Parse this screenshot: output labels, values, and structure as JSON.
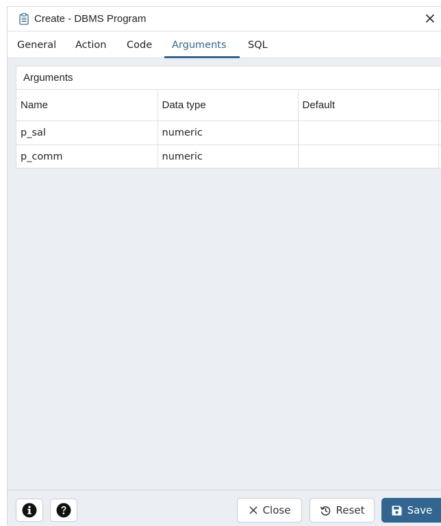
{
  "dialog": {
    "title": "Create - DBMS Program",
    "title_icon": "clipboard-icon",
    "close_icon": "close-icon"
  },
  "tabs": [
    {
      "label": "General",
      "active": false
    },
    {
      "label": "Action",
      "active": false
    },
    {
      "label": "Code",
      "active": false
    },
    {
      "label": "Arguments",
      "active": true
    },
    {
      "label": "SQL",
      "active": false
    }
  ],
  "arguments_panel": {
    "header": "Arguments",
    "columns": [
      "Name",
      "Data type",
      "Default"
    ],
    "rows": [
      {
        "name": "p_sal",
        "data_type": "numeric",
        "default": ""
      },
      {
        "name": "p_comm",
        "data_type": "numeric",
        "default": ""
      }
    ]
  },
  "footer": {
    "info_icon": "info-icon",
    "help_icon": "help-icon",
    "close_label": "Close",
    "reset_label": "Reset",
    "save_label": "Save"
  },
  "colors": {
    "accent": "#326690",
    "background": "#ebeef3",
    "border": "#dde0e6"
  }
}
